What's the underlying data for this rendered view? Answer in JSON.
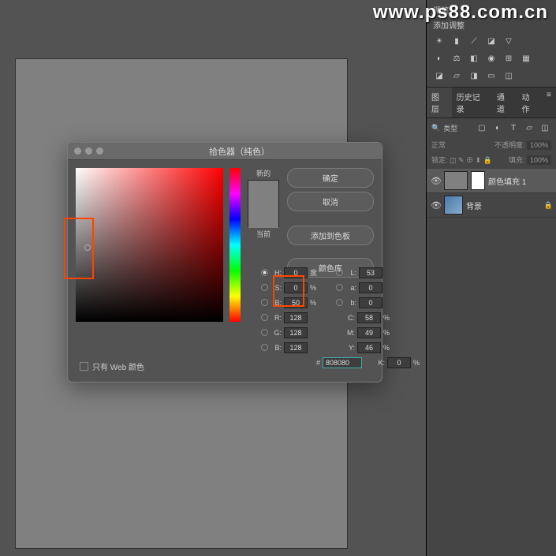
{
  "watermark": "www.ps88.com.cn",
  "adjustments": {
    "title1": "调整",
    "title2": "添加调整"
  },
  "panel_tabs": {
    "layers": "图层",
    "history": "历史记录",
    "channels": "通道",
    "actions": "动作"
  },
  "layer_filter": {
    "label": "类型"
  },
  "blend": {
    "mode": "正常",
    "opacity_label": "不透明度:",
    "opacity_value": "100%",
    "lock_label": "锁定:",
    "fill_label": "填充:",
    "fill_value": "100%"
  },
  "layers": [
    {
      "name": "颜色填充 1"
    },
    {
      "name": "背景"
    }
  ],
  "picker": {
    "title": "拾色器（纯色）",
    "new_label": "新的",
    "current_label": "当前",
    "ok": "确定",
    "cancel": "取消",
    "add_swatch": "添加到色板",
    "color_lib": "颜色库",
    "web_only": "只有 Web 颜色",
    "H": "0",
    "H_unit": "度",
    "S": "0",
    "S_unit": "%",
    "B": "50",
    "B_unit": "%",
    "R": "128",
    "G": "128",
    "Bb": "128",
    "L": "53",
    "a": "0",
    "b": "0",
    "C": "58",
    "C_unit": "%",
    "M": "49",
    "M_unit": "%",
    "Y": "46",
    "Y_unit": "%",
    "K": "0",
    "K_unit": "%",
    "hex_prefix": "#",
    "hex": "808080"
  }
}
